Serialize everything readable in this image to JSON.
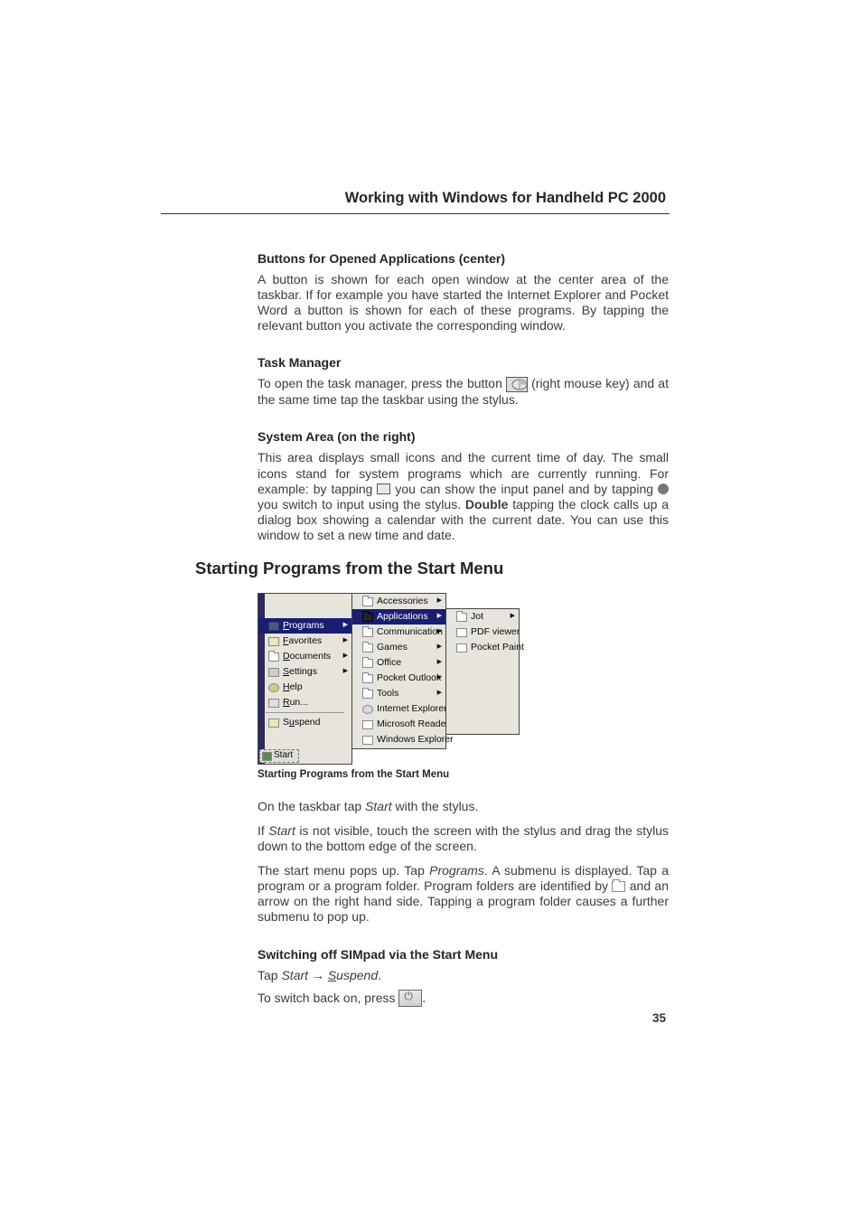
{
  "header": {
    "title": "Working with Windows for Handheld PC 2000"
  },
  "sections": {
    "buttons_apps": {
      "heading": "Buttons for Opened Applications (center)",
      "body": "A button is shown for each open window at the center area of the taskbar. If for  example you have started the Internet Explorer and Pocket Word a button is shown for each of these programs. By tapping the relevant button you activate the corresponding window."
    },
    "task_manager": {
      "heading": "Task Manager",
      "pre": "To open the task manager, press the button ",
      "post": " (right mouse key) and at the same time tap the taskbar using the stylus."
    },
    "system_area": {
      "heading": "System Area (on the right)",
      "p1a": "This area displays small icons and the current time of day. The small icons stand for system programs which are currently running. For example: by tapping ",
      "p1b": " you can show the input panel and by tapping ",
      "p1c": " you switch to input using the stylus. ",
      "dbl": "Double",
      "p1d": " tapping the clock calls up a dialog box showing a calendar with the current date. You can use this window to set a new time and date."
    },
    "start_programs": {
      "title": "Starting Programs from the Start Menu",
      "caption": "Starting Programs from the Start Menu",
      "p1a": "On the taskbar tap ",
      "start_i": "Start",
      "p1b": " with the stylus.",
      "p2a": "If ",
      "p2b": " is not visible, touch the screen with the stylus and drag the stylus down to the bottom edge of the screen.",
      "p3a": "The start menu pops up. Tap ",
      "programs_i": "Programs",
      "p3b": ". A submenu is displayed. Tap a program or a program folder. Program folders are identified by ",
      "p3c": " and an arrow on the right hand side. Tapping a program folder causes a further submenu to pop up."
    },
    "switch_off": {
      "heading": "Switching off SIMpad via the Start Menu",
      "tap": "Tap ",
      "start_i": "Start",
      "arrow": " → ",
      "suspend_i": "Suspend",
      "dot": ".",
      "back_on": "To switch back on, press ",
      "dot2": "."
    }
  },
  "startmenu": {
    "left": [
      {
        "label": "Programs",
        "icon": "programs",
        "arrow": true,
        "selected": true,
        "underline_first": true
      },
      {
        "label": "Favorites",
        "icon": "fav",
        "arrow": true,
        "underline_first": true
      },
      {
        "label": "Documents",
        "icon": "folder",
        "arrow": true,
        "underline_first": true
      },
      {
        "label": "Settings",
        "icon": "settings",
        "arrow": true,
        "underline_first": true
      },
      {
        "label": "Help",
        "icon": "help",
        "underline_first": true
      },
      {
        "label": "Run...",
        "icon": "run",
        "underline_first": true
      }
    ],
    "left_sep_then": [
      {
        "label": "Suspend",
        "icon": "suspend",
        "underline_at": 1
      }
    ],
    "start_label": "Start",
    "mid": [
      {
        "label": "Accessories",
        "icon": "folder",
        "arrow": true
      },
      {
        "label": "Applications",
        "icon": "darkfolder",
        "arrow": true,
        "selected": true
      },
      {
        "label": "Communication",
        "icon": "folder",
        "arrow": true
      },
      {
        "label": "Games",
        "icon": "folder",
        "arrow": true
      },
      {
        "label": "Office",
        "icon": "folder",
        "arrow": true
      },
      {
        "label": "Pocket Outlook",
        "icon": "folder",
        "arrow": true
      },
      {
        "label": "Tools",
        "icon": "folder",
        "arrow": true
      },
      {
        "label": "Internet Explorer",
        "icon": "ie"
      },
      {
        "label": "Microsoft Reader",
        "icon": "reader"
      },
      {
        "label": "Windows Explorer",
        "icon": "we"
      }
    ],
    "right": [
      {
        "label": "Jot",
        "icon": "folder",
        "arrow": true
      },
      {
        "label": "PDF viewer",
        "icon": "pdf"
      },
      {
        "label": "Pocket Paint",
        "icon": "paint"
      }
    ]
  },
  "page_number": "35"
}
